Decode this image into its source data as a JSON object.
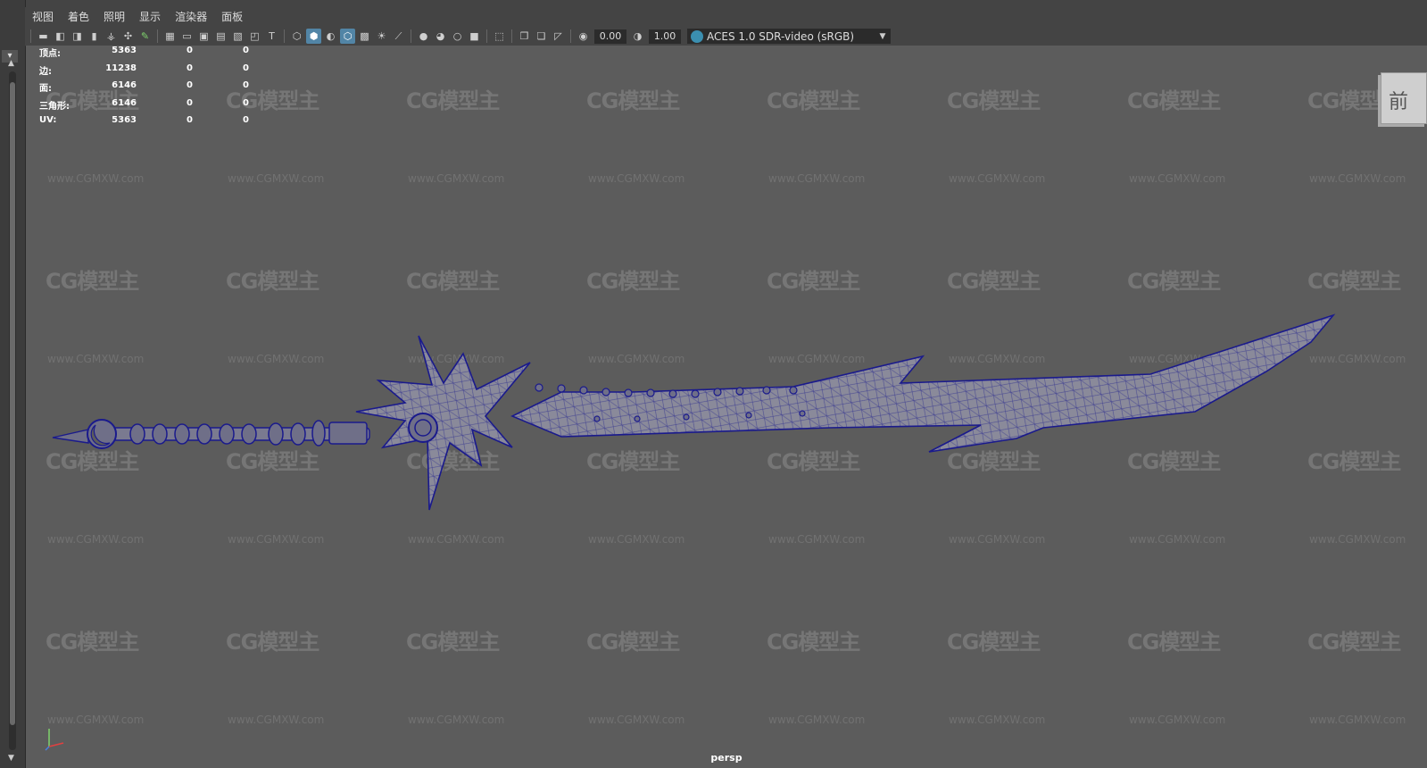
{
  "menu": [
    "视图",
    "着色",
    "照明",
    "显示",
    "渲染器",
    "面板"
  ],
  "toolbar": {
    "exposure_value": "0.00",
    "gamma_value": "1.00",
    "color_space": "ACES 1.0 SDR-video (sRGB)"
  },
  "hud": {
    "rows": [
      {
        "label": "顶点:",
        "v1": "5363",
        "v2": "0",
        "v3": "0"
      },
      {
        "label": "边:",
        "v1": "11238",
        "v2": "0",
        "v3": "0"
      },
      {
        "label": "面:",
        "v1": "6146",
        "v2": "0",
        "v3": "0"
      },
      {
        "label": "三角形:",
        "v1": "6146",
        "v2": "0",
        "v3": "0"
      },
      {
        "label": "UV:",
        "v1": "5363",
        "v2": "0",
        "v3": "0"
      }
    ]
  },
  "viewcube_label": "前",
  "camera_label": "persp",
  "watermark": {
    "logo": "CG模型主",
    "url": "www.CGMXW.com"
  },
  "colors": {
    "viewport_bg": "#5c5c5c",
    "wire": "#1a1a8c",
    "sword_fill": "#8a8a9a",
    "highlight": "#5285a6"
  }
}
